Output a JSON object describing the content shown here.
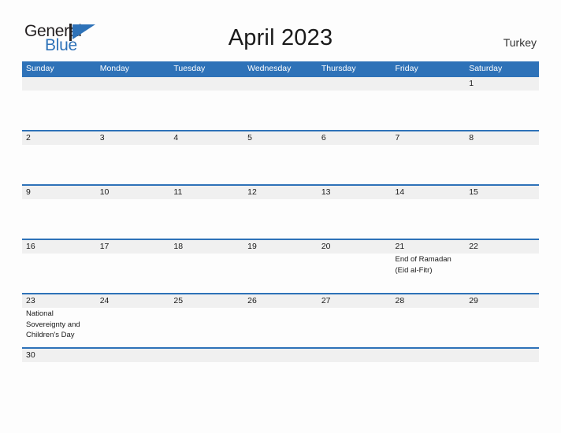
{
  "branding": {
    "logo_text_primary": "General",
    "logo_text_secondary": "Blue",
    "logo_icon": "triangle-flag-icon",
    "color_blue": "#2e72b8",
    "color_dark": "#231f20"
  },
  "header": {
    "title": "April 2023",
    "country": "Turkey"
  },
  "calendar": {
    "month": "April",
    "year": "2023",
    "weekday_headers": [
      "Sunday",
      "Monday",
      "Tuesday",
      "Wednesday",
      "Thursday",
      "Friday",
      "Saturday"
    ],
    "weeks": [
      {
        "dates": [
          "",
          "",
          "",
          "",
          "",
          "",
          "1"
        ],
        "events": [
          "",
          "",
          "",
          "",
          "",
          "",
          ""
        ]
      },
      {
        "dates": [
          "2",
          "3",
          "4",
          "5",
          "6",
          "7",
          "8"
        ],
        "events": [
          "",
          "",
          "",
          "",
          "",
          "",
          ""
        ]
      },
      {
        "dates": [
          "9",
          "10",
          "11",
          "12",
          "13",
          "14",
          "15"
        ],
        "events": [
          "",
          "",
          "",
          "",
          "",
          "",
          ""
        ]
      },
      {
        "dates": [
          "16",
          "17",
          "18",
          "19",
          "20",
          "21",
          "22"
        ],
        "events": [
          "",
          "",
          "",
          "",
          "",
          "End of Ramadan (Eid al-Fitr)",
          ""
        ]
      },
      {
        "dates": [
          "23",
          "24",
          "25",
          "26",
          "27",
          "28",
          "29"
        ],
        "events": [
          "National Sovereignty and Children's Day",
          "",
          "",
          "",
          "",
          "",
          ""
        ]
      },
      {
        "dates": [
          "30",
          "",
          "",
          "",
          "",
          "",
          ""
        ],
        "events": [
          "",
          "",
          "",
          "",
          "",
          "",
          ""
        ]
      }
    ],
    "holidays": [
      {
        "date": "21",
        "name": "End of Ramadan (Eid al-Fitr)"
      },
      {
        "date": "23",
        "name": "National Sovereignty and Children's Day"
      }
    ]
  }
}
